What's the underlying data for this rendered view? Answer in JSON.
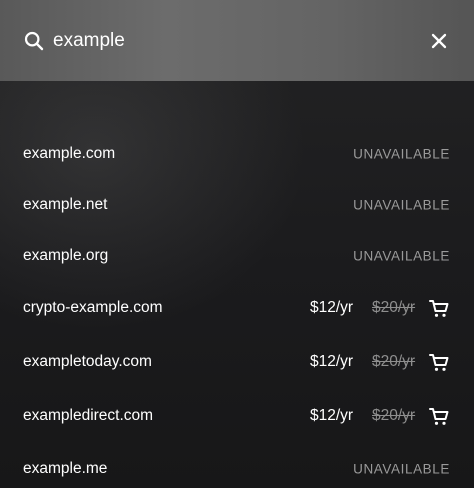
{
  "search": {
    "query": "example",
    "search_icon": "search-icon",
    "close_icon": "close-icon"
  },
  "colors": {
    "search_bar": "#666666",
    "background": "#1c1c1d",
    "text": "#ffffff",
    "muted": "#9a9a9a"
  },
  "results": [
    {
      "domain": "example.com",
      "status": "UNAVAILABLE"
    },
    {
      "domain": "example.net",
      "status": "UNAVAILABLE"
    },
    {
      "domain": "example.org",
      "status": "UNAVAILABLE"
    },
    {
      "domain": "crypto-example.com",
      "price": "$12/yr",
      "old_price": "$20/yr",
      "cart_icon": "cart-icon"
    },
    {
      "domain": "exampletoday.com",
      "price": "$12/yr",
      "old_price": "$20/yr",
      "cart_icon": "cart-icon"
    },
    {
      "domain": "exampledirect.com",
      "price": "$12/yr",
      "old_price": "$20/yr",
      "cart_icon": "cart-icon"
    },
    {
      "domain": "example.me",
      "status": "UNAVAILABLE"
    }
  ]
}
